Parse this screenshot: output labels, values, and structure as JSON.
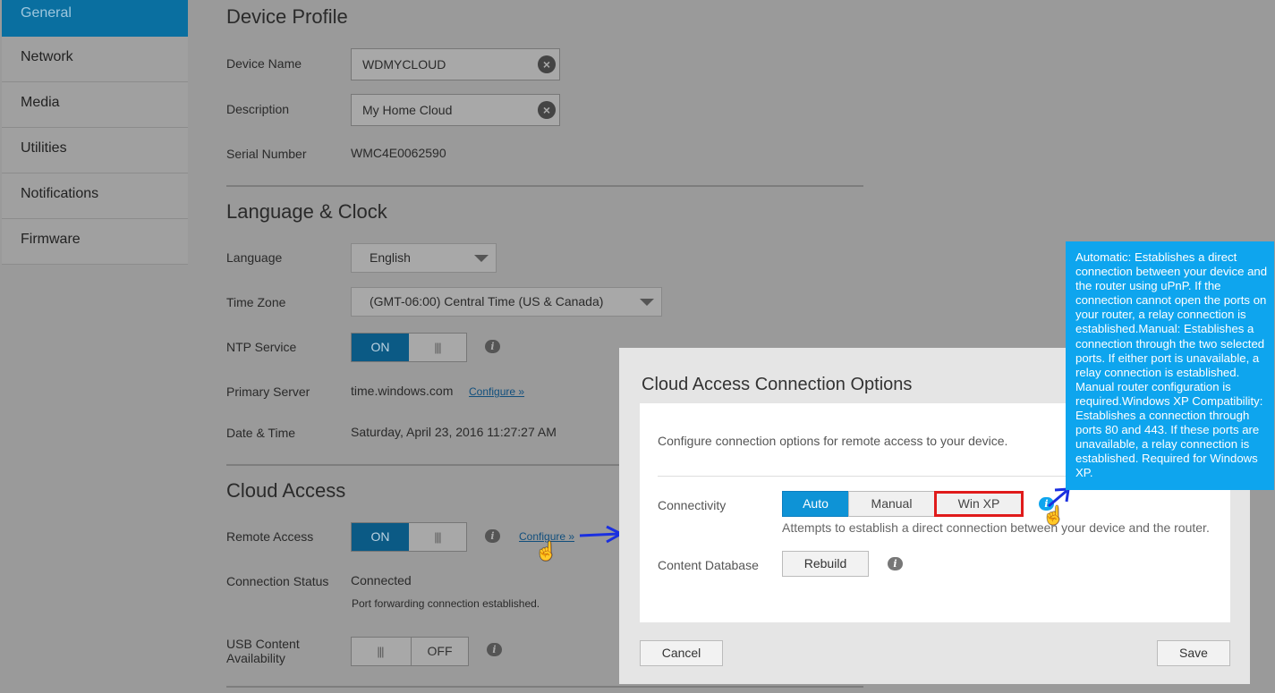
{
  "sidebar": {
    "items": [
      {
        "label": "General"
      },
      {
        "label": "Network"
      },
      {
        "label": "Media"
      },
      {
        "label": "Utilities"
      },
      {
        "label": "Notifications"
      },
      {
        "label": "Firmware"
      }
    ]
  },
  "device_profile": {
    "title": "Device Profile",
    "device_name_label": "Device Name",
    "device_name_value": "WDMYCLOUD",
    "description_label": "Description",
    "description_value": "My Home Cloud",
    "serial_label": "Serial Number",
    "serial_value": "WMC4E0062590"
  },
  "language_clock": {
    "title": "Language & Clock",
    "language_label": "Language",
    "language_value": "English",
    "timezone_label": "Time Zone",
    "timezone_value": "(GMT-06:00) Central Time (US & Canada)",
    "ntp_label": "NTP Service",
    "ntp_state": "ON",
    "primary_server_label": "Primary Server",
    "primary_server_value": "time.windows.com",
    "configure_link": "Configure »",
    "datetime_label": "Date & Time",
    "datetime_value": "Saturday, April 23, 2016 11:27:27 AM"
  },
  "cloud_access": {
    "title": "Cloud Access",
    "remote_access_label": "Remote Access",
    "remote_access_state": "ON",
    "configure_link": "Configure »",
    "connection_status_label": "Connection Status",
    "connection_status_value": "Connected",
    "connection_status_detail": "Port forwarding connection established.",
    "usb_label_line1": "USB Content",
    "usb_label_line2": "Availability",
    "usb_state": "OFF"
  },
  "modal": {
    "title": "Cloud Access Connection Options",
    "description": "Configure connection options for remote access to your device.",
    "connectivity_label": "Connectivity",
    "options": [
      "Auto",
      "Manual",
      "Win XP"
    ],
    "selected_option": "Auto",
    "hint": "Attempts to establish a direct connection between your device and the router.",
    "content_db_label": "Content Database",
    "rebuild_label": "Rebuild",
    "cancel_label": "Cancel",
    "save_label": "Save"
  },
  "tooltip": {
    "text": "Automatic: Establishes a direct connection between your device and the router using uPnP. If the connection cannot open the ports on your router, a relay connection is established.Manual: Establishes a connection through the two selected ports. If either port is unavailable, a relay connection is established. Manual router configuration is required.Windows XP Compatibility: Establishes a connection through ports 80 and 443. If these ports are unavailable, a relay connection is established. Required for Windows XP."
  },
  "colors": {
    "accent": "#0e93d6",
    "sidebar_active": "#0a6fa0",
    "highlight_box": "#e01b1b",
    "tooltip_bg": "#0ea5ee",
    "annotation_arrow": "#1a2fe0"
  }
}
